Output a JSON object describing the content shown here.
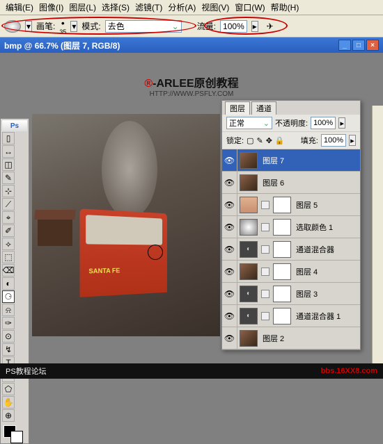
{
  "menus": [
    "编辑(E)",
    "图像(I)",
    "图层(L)",
    "选择(S)",
    "滤镜(T)",
    "分析(A)",
    "视图(V)",
    "窗口(W)",
    "帮助(H)"
  ],
  "optbar": {
    "brush_label": "画笔:",
    "brush_size": "35",
    "mode_label": "模式:",
    "mode_value": "去色",
    "flow_label": "流量:",
    "flow_value": "100%"
  },
  "doc_title": "bmp @ 66.7% (图层 7, RGB/8)",
  "brand_r": "®",
  "brand_text": "-ARLEE原创教程",
  "brand_url": "HTTP://WWW.PSFLY.COM",
  "toolbox_hdr": "Ps",
  "tools": [
    "▯",
    "↔",
    "◫",
    "✎",
    "⊹",
    "⟋",
    "⌖",
    "✐",
    "⟡",
    "⬚",
    "⌫",
    "◐",
    "⚆",
    "⍾",
    "✑",
    "⊙",
    "↯",
    "T",
    "▭",
    "⬠",
    "✋",
    "⊕"
  ],
  "layers": {
    "tabs": [
      "图层",
      "通道"
    ],
    "blend_label": "正常",
    "opacity_label": "不透明度:",
    "opacity_value": "100%",
    "lock_label": "锁定:",
    "fill_label": "填充:",
    "fill_value": "100%",
    "items": [
      {
        "name": "图层 7",
        "sel": true,
        "thumbs": [
          "train"
        ]
      },
      {
        "name": "图层 6",
        "thumbs": [
          "train"
        ]
      },
      {
        "name": "图层 5",
        "thumbs": [
          "skin",
          "mask"
        ]
      },
      {
        "name": "选取颜色 1",
        "thumbs": [
          "circle",
          "mask"
        ]
      },
      {
        "name": "通道混合器",
        "thumbs": [
          "adj",
          "mask"
        ]
      },
      {
        "name": "图层 4",
        "thumbs": [
          "train",
          "mask"
        ]
      },
      {
        "name": "图层 3",
        "thumbs": [
          "adj",
          "mask"
        ]
      },
      {
        "name": "通道混合器 1",
        "thumbs": [
          "adj",
          "mask"
        ]
      },
      {
        "name": "图层 2",
        "thumbs": [
          "train"
        ]
      }
    ]
  },
  "footer": {
    "forum": "PS教程论坛",
    "site": "bbs.16XX8.com"
  }
}
